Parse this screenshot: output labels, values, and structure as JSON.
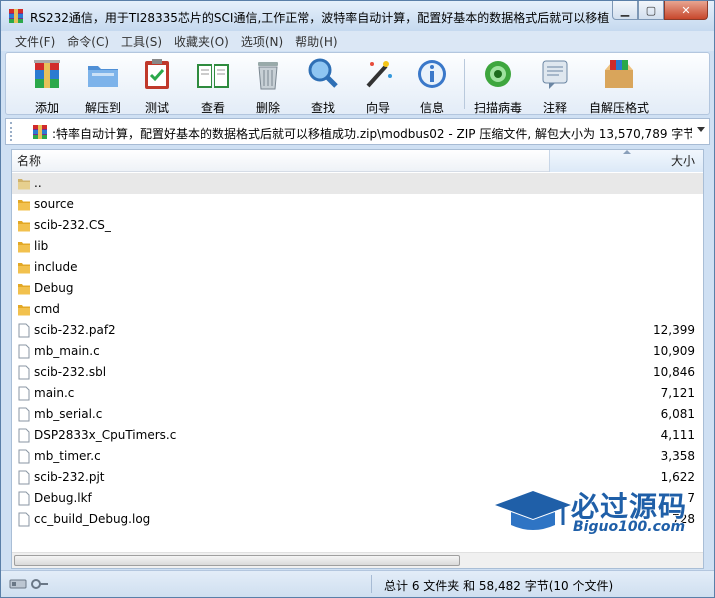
{
  "window": {
    "title": "RS232通信，用于TI28335芯片的SCI通信,工作正常，波特率自动计算，配置好基本的数据格式后就可以移植..."
  },
  "menu": [
    {
      "label": "文件(F)"
    },
    {
      "label": "命令(C)"
    },
    {
      "label": "工具(S)"
    },
    {
      "label": "收藏夹(O)"
    },
    {
      "label": "选项(N)"
    },
    {
      "label": "帮助(H)"
    }
  ],
  "toolbar": [
    {
      "label": "添加",
      "icon": "winrar-add-icon"
    },
    {
      "label": "解压到",
      "icon": "extract-folder-icon"
    },
    {
      "label": "测试",
      "icon": "test-clipboard-icon"
    },
    {
      "label": "查看",
      "icon": "view-book-icon"
    },
    {
      "label": "删除",
      "icon": "trash-can-icon"
    },
    {
      "label": "查找",
      "icon": "magnifier-icon"
    },
    {
      "label": "向导",
      "icon": "wizard-wand-icon"
    },
    {
      "label": "信息",
      "icon": "info-icon"
    },
    {
      "label": "扫描病毒",
      "icon": "virus-scan-icon"
    },
    {
      "label": "注释",
      "icon": "comment-icon"
    },
    {
      "label": "自解压格式",
      "icon": "sfx-box-icon"
    }
  ],
  "address": {
    "text": ":特率自动计算，配置好基本的数据格式后就可以移植成功.zip\\modbus02 - ZIP 压缩文件, 解包大小为 13,570,789 字节"
  },
  "columns": {
    "name": "名称",
    "size": "大小"
  },
  "files": [
    {
      "name": "..",
      "size": "",
      "type": "parent"
    },
    {
      "name": "source",
      "size": "",
      "type": "folder"
    },
    {
      "name": "scib-232.CS_",
      "size": "",
      "type": "folder"
    },
    {
      "name": "lib",
      "size": "",
      "type": "folder"
    },
    {
      "name": "include",
      "size": "",
      "type": "folder"
    },
    {
      "name": "Debug",
      "size": "",
      "type": "folder"
    },
    {
      "name": "cmd",
      "size": "",
      "type": "folder"
    },
    {
      "name": "scib-232.paf2",
      "size": "12,399",
      "type": "file"
    },
    {
      "name": "mb_main.c",
      "size": "10,909",
      "type": "file"
    },
    {
      "name": "scib-232.sbl",
      "size": "10,846",
      "type": "file"
    },
    {
      "name": "main.c",
      "size": "7,121",
      "type": "file"
    },
    {
      "name": "mb_serial.c",
      "size": "6,081",
      "type": "file"
    },
    {
      "name": "DSP2833x_CpuTimers.c",
      "size": "4,111",
      "type": "file"
    },
    {
      "name": "mb_timer.c",
      "size": "3,358",
      "type": "file"
    },
    {
      "name": "scib-232.pjt",
      "size": "1,622",
      "type": "file"
    },
    {
      "name": "Debug.lkf",
      "size": "7",
      "type": "file"
    },
    {
      "name": "cc_build_Debug.log",
      "size": "728",
      "type": "file"
    }
  ],
  "status": {
    "text": "总计 6 文件夹 和 58,482 字节(10 个文件)"
  },
  "watermark": {
    "big": "必过源码",
    "small": "Biguo100.com"
  },
  "colors": {
    "folder": "#f2c14e",
    "accent": "#1f5fa8"
  }
}
